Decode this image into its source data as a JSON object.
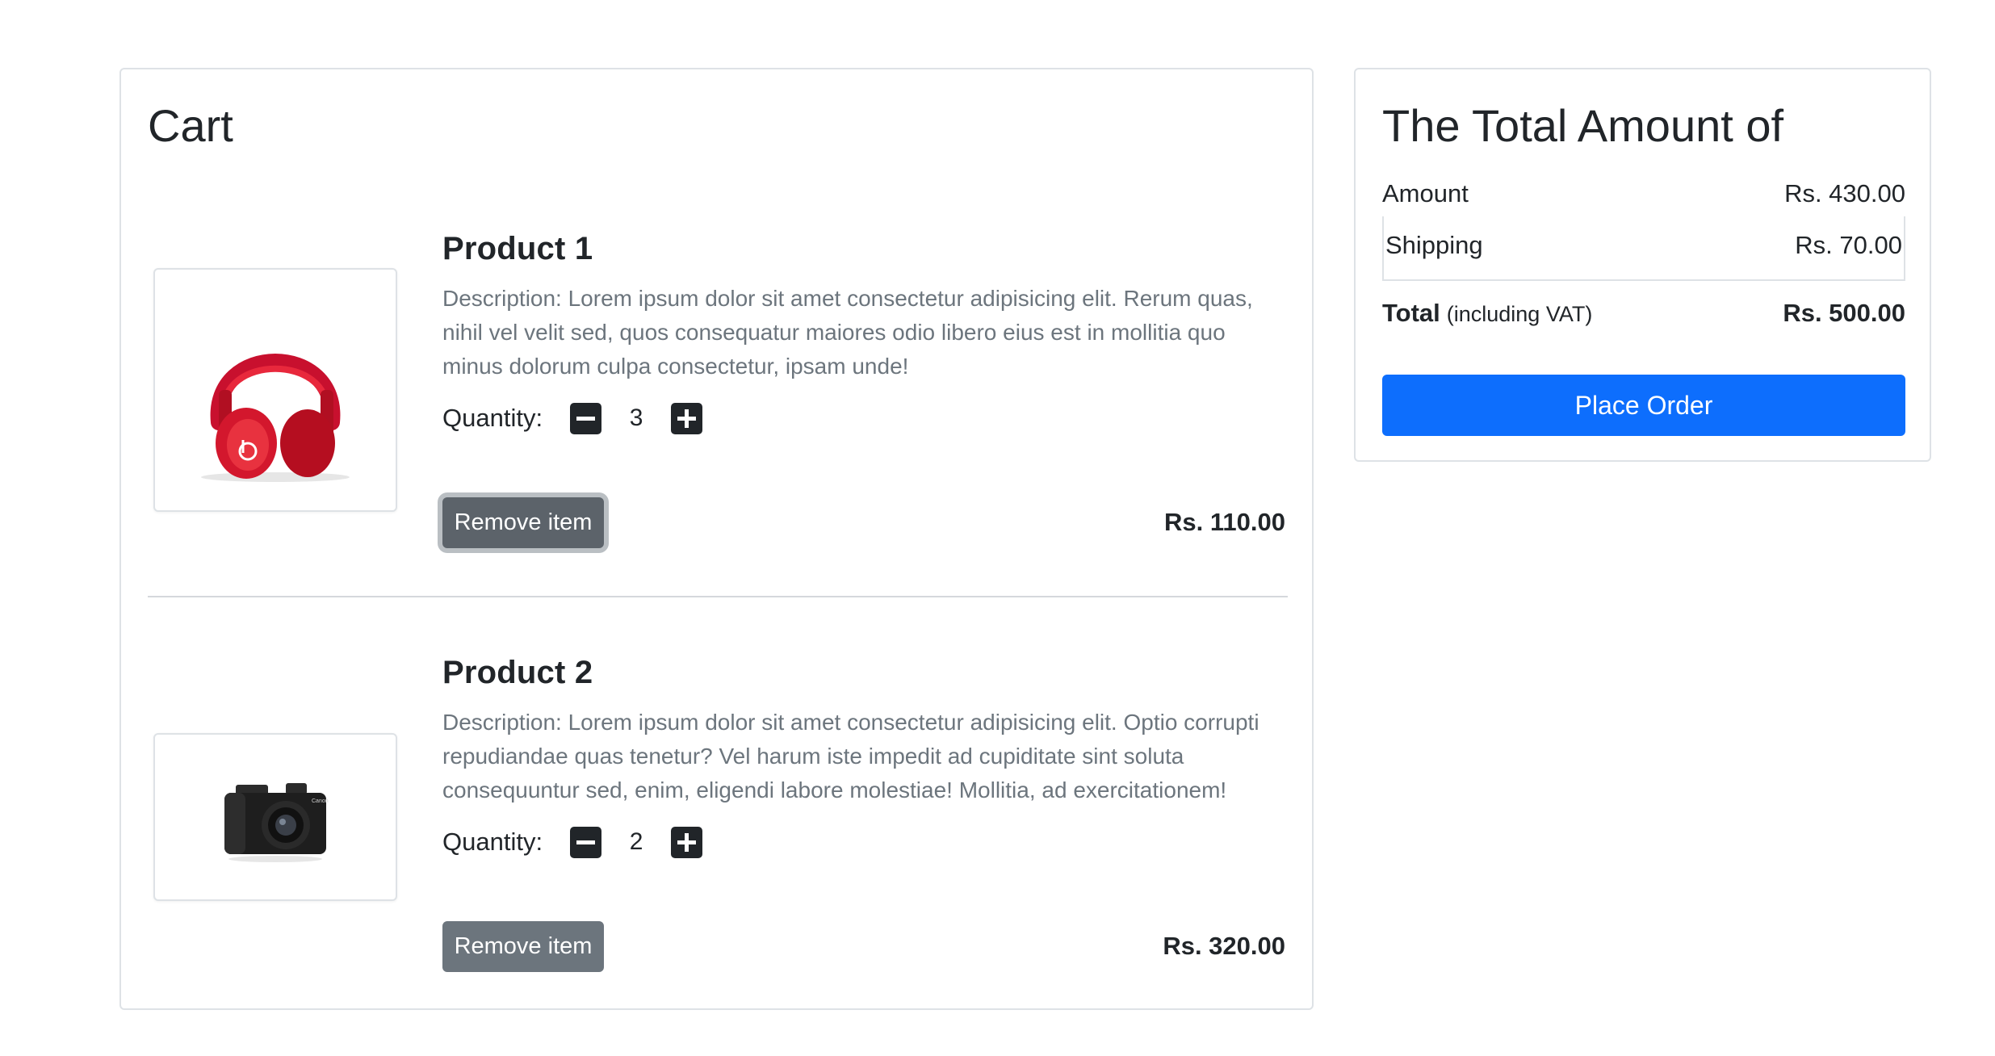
{
  "cart": {
    "title": "Cart",
    "items": [
      {
        "title": "Product 1",
        "image": "red-headphones-image",
        "description": "Description: Lorem ipsum dolor sit amet consectetur adipisicing elit. Rerum quas, nihil vel velit sed, quos consequatur maiores odio libero eius est in mollitia quo minus dolorum culpa consectetur, ipsam unde!",
        "quantity_label": "Quantity:",
        "quantity": "3",
        "remove_label": "Remove item",
        "price": "Rs. 110.00"
      },
      {
        "title": "Product 2",
        "image": "black-camera-image",
        "description": "Description: Lorem ipsum dolor sit amet consectetur adipisicing elit. Optio corrupti repudiandae quas tenetur? Vel harum iste impedit ad cupiditate sint soluta consequuntur sed, enim, eligendi labore molestiae! Mollitia, ad exercitationem!",
        "quantity_label": "Quantity:",
        "quantity": "2",
        "remove_label": "Remove item",
        "price": "Rs. 320.00"
      }
    ]
  },
  "summary": {
    "title": "The Total Amount of",
    "amount_label": "Amount",
    "amount_value": "Rs. 430.00",
    "shipping_label": "Shipping",
    "shipping_value": "Rs. 70.00",
    "total_label": "Total",
    "total_note": "(including VAT)",
    "total_value": "Rs. 500.00",
    "order_button": "Place Order"
  },
  "colors": {
    "primary": "#0d6efd",
    "secondary": "#6c757d",
    "dark": "#212529"
  }
}
